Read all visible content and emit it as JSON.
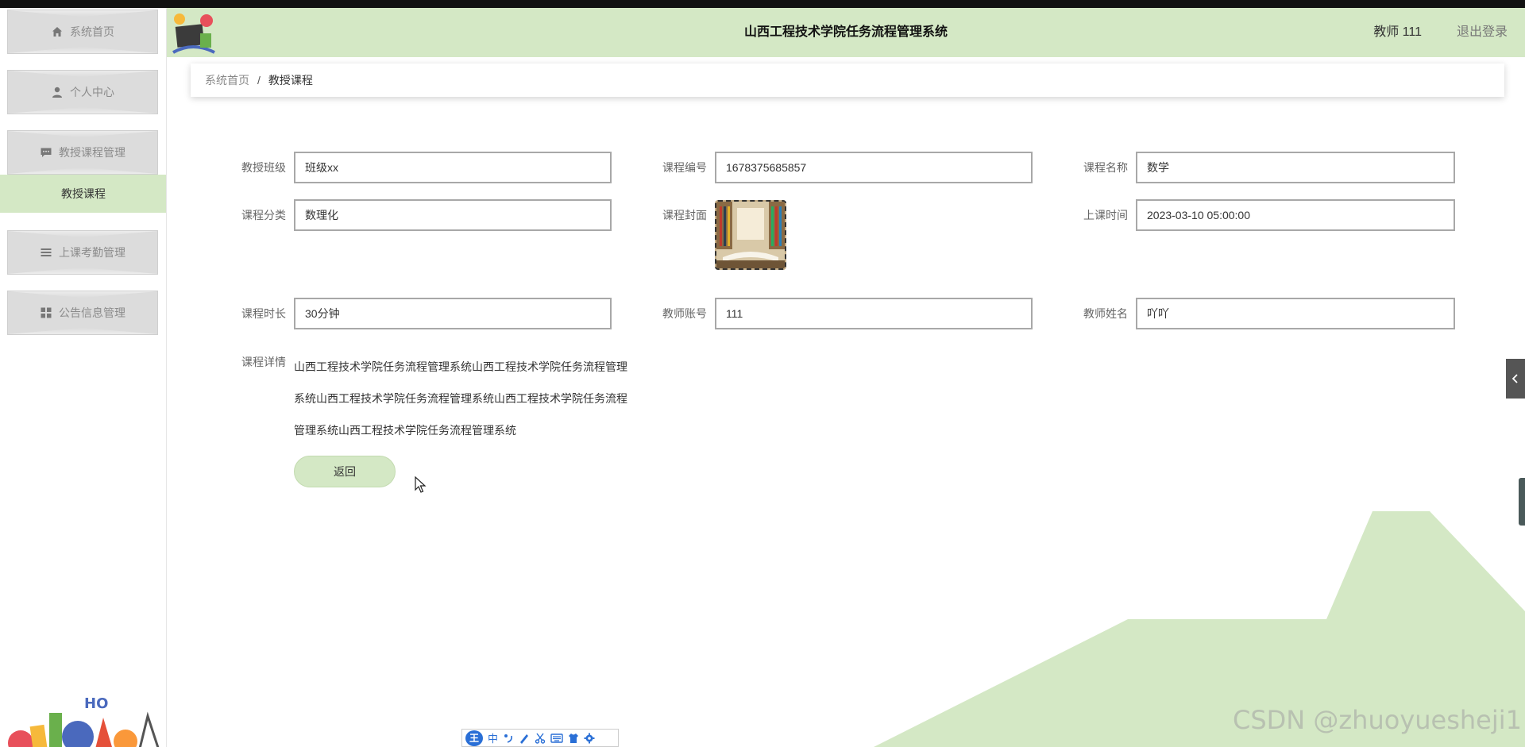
{
  "app": {
    "title": "山西工程技术学院任务流程管理系统",
    "user": "教师 111",
    "logout": "退出登录"
  },
  "sidebar": {
    "items": [
      {
        "label": "系统首页",
        "icon": "home-icon"
      },
      {
        "label": "个人中心",
        "icon": "person-icon"
      },
      {
        "label": "教授课程管理",
        "icon": "message-icon"
      },
      {
        "label": "上课考勤管理",
        "icon": "list-icon"
      },
      {
        "label": "公告信息管理",
        "icon": "grid-icon"
      }
    ],
    "active_sub": "教授课程"
  },
  "breadcrumb": {
    "home": "系统首页",
    "separator": "/",
    "current": "教授课程"
  },
  "form": {
    "class_label": "教授班级",
    "class_value": "班级xx",
    "code_label": "课程编号",
    "code_value": "1678375685857",
    "name_label": "课程名称",
    "name_value": "数学",
    "category_label": "课程分类",
    "category_value": "数理化",
    "cover_label": "课程封面",
    "time_label": "上课时间",
    "time_value": "2023-03-10 05:00:00",
    "duration_label": "课程时长",
    "duration_value": "30分钟",
    "teacher_account_label": "教师账号",
    "teacher_account_value": "111",
    "teacher_name_label": "教师姓名",
    "teacher_name_value": "吖吖",
    "detail_label": "课程详情",
    "detail_value": "山西工程技术学院任务流程管理系统山西工程技术学院任务流程管理系统山西工程技术学院任务流程管理系统山西工程技术学院任务流程管理系统山西工程技术学院任务流程管理系统",
    "back_button": "返回"
  },
  "ime": {
    "logo": "王",
    "mode": "中"
  },
  "watermark": "CSDN @zhuoyueshejі1",
  "colors": {
    "accent_green": "#d4e8c5",
    "menu_grey": "#dcdcdc"
  }
}
